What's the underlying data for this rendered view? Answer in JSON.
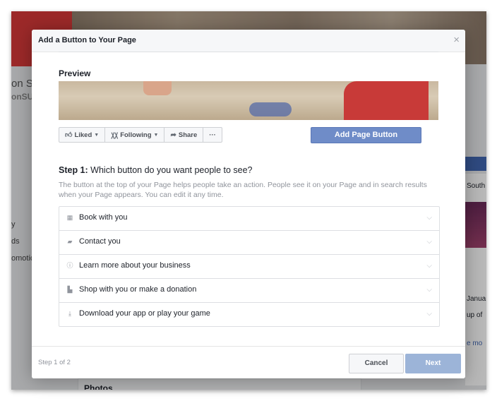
{
  "background": {
    "page_name_partial": "on S",
    "page_handle_partial": "onSUI",
    "left_items": [
      "y",
      "ds",
      "",
      "omotic"
    ],
    "right_text": [
      "South",
      "Janua",
      "up of",
      "e mo"
    ],
    "photos_label": "Photos"
  },
  "dialog": {
    "title": "Add a Button to Your Page",
    "close_label": "×",
    "preview_label": "Preview",
    "action_bar": {
      "liked_label": "Liked",
      "following_label": "Following",
      "share_label": "Share",
      "more_label": "···"
    },
    "add_page_button_label": "Add Page Button",
    "step": {
      "prefix": "Step 1:",
      "question": "Which button do you want people to see?",
      "description": "The button at the top of your Page helps people take an action. People see it on your Page and in search results when your Page appears. You can edit it any time."
    },
    "options": [
      {
        "label": "Book with you",
        "icon": "calendar-icon"
      },
      {
        "label": "Contact you",
        "icon": "chat-icon"
      },
      {
        "label": "Learn more about your business",
        "icon": "info-icon"
      },
      {
        "label": "Shop with you or make a donation",
        "icon": "shopping-bag-icon"
      },
      {
        "label": "Download your app or play your game",
        "icon": "download-icon"
      }
    ],
    "footer": {
      "step_count": "Step 1 of 2",
      "cancel_label": "Cancel",
      "next_label": "Next"
    }
  },
  "colors": {
    "primary_button": "#6f8cc8",
    "next_disabled": "#9cb4d8",
    "facebook_blue": "#4267b2"
  }
}
